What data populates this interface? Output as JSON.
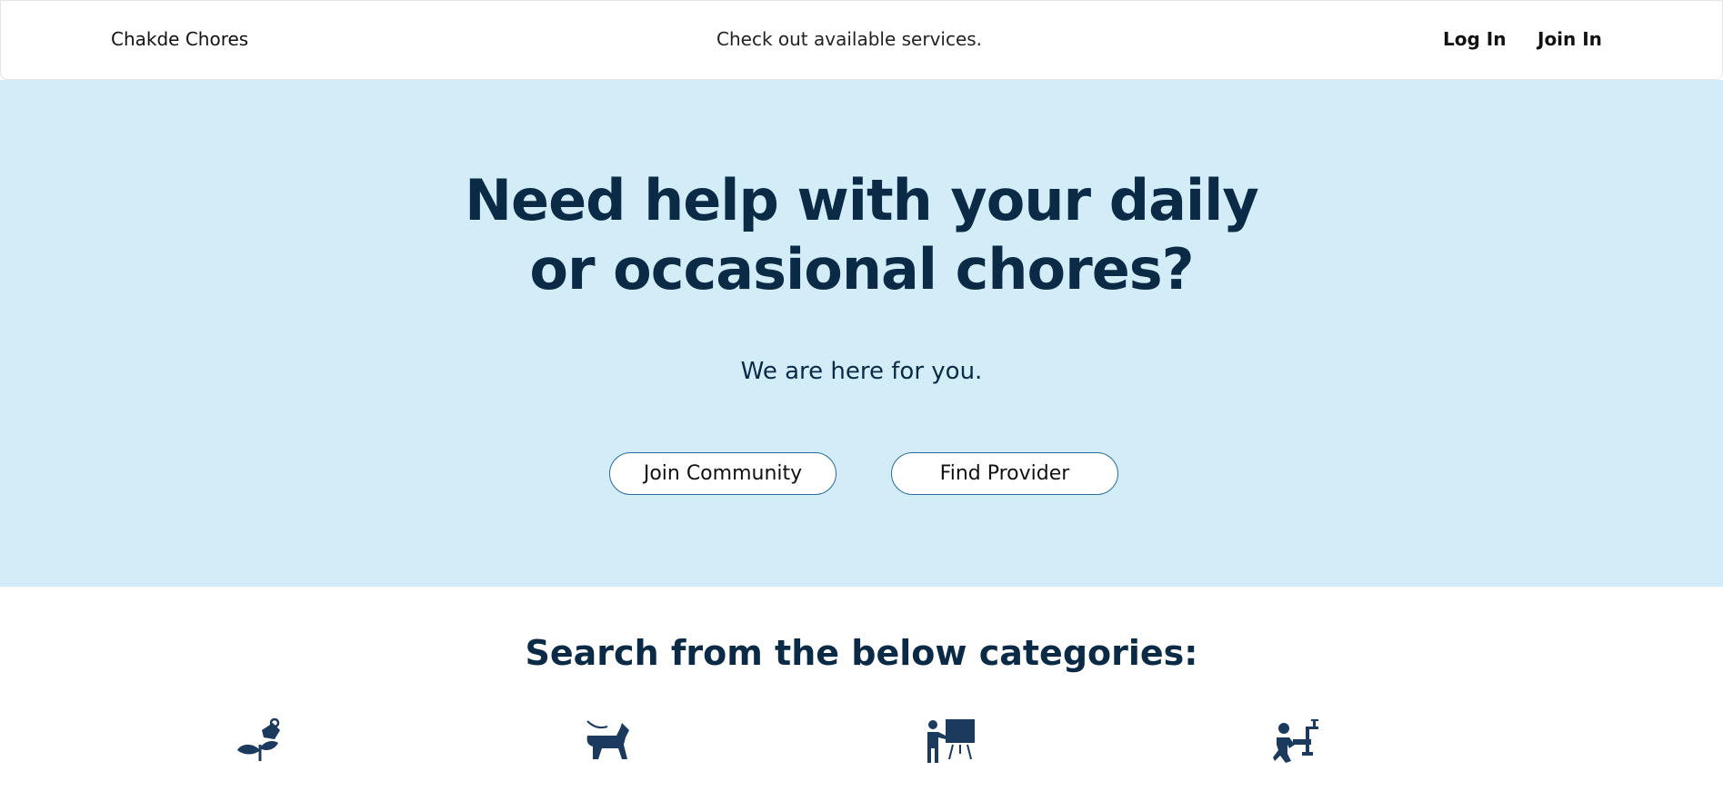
{
  "header": {
    "brand": "Chakde Chores",
    "tagline": "Check out available services.",
    "login_label": "Log In",
    "join_label": "Join In"
  },
  "hero": {
    "title_line1": "Need help with your daily",
    "title_line2": "or occasional chores?",
    "subtitle": "We are here for you.",
    "join_community_label": "Join Community",
    "find_provider_label": "Find Provider"
  },
  "categories": {
    "heading": "Search from the below categories:",
    "icons": [
      "gardening-icon",
      "dog-walking-icon",
      "tutoring-icon",
      "plumbing-icon"
    ]
  },
  "colors": {
    "hero_background": "#d2ecf8",
    "heading_text": "#0b2a45",
    "button_border": "#2a6b9c",
    "icon_fill": "#1c3a5e"
  }
}
